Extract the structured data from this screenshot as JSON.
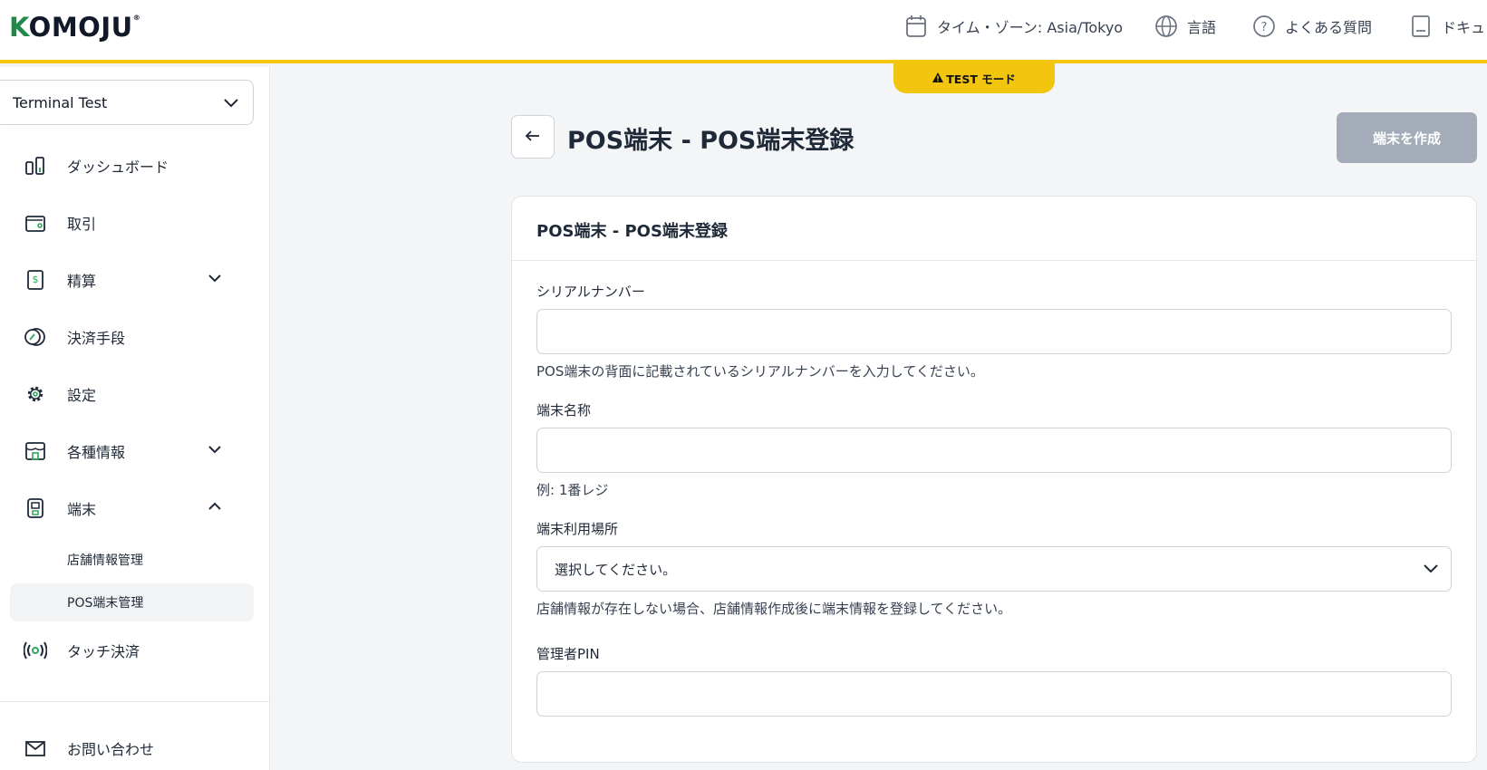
{
  "header": {
    "logo": "KOMOJU",
    "timezone_label": "タイム・ゾーン: Asia/Tokyo",
    "language_label": "言語",
    "faq_label": "よくある質問",
    "docs_label": "ドキュ"
  },
  "test_badge": "TEST モード",
  "sidebar": {
    "account": "Terminal Test",
    "items": [
      {
        "label": "ダッシュボード",
        "icon": "dashboard-icon"
      },
      {
        "label": "取引",
        "icon": "wallet-icon"
      },
      {
        "label": "精算",
        "icon": "settlement-icon",
        "expandable": true,
        "expanded": false
      },
      {
        "label": "決済手段",
        "icon": "payment-method-icon"
      },
      {
        "label": "設定",
        "icon": "gear-icon"
      },
      {
        "label": "各種情報",
        "icon": "store-icon",
        "expandable": true,
        "expanded": false
      },
      {
        "label": "端末",
        "icon": "terminal-icon",
        "expandable": true,
        "expanded": true
      }
    ],
    "subitems": [
      {
        "label": "店舗情報管理",
        "active": false
      },
      {
        "label": "POS端末管理",
        "active": true
      }
    ],
    "touch_payment": "タッチ決済",
    "contact": "お問い合わせ"
  },
  "page": {
    "title": "POS端末 - POS端末登録",
    "create_button": "端末を作成"
  },
  "card": {
    "title": "POS端末 - POS端末登録",
    "serial_label": "シリアルナンバー",
    "serial_value": "",
    "serial_help": "POS端末の背面に記載されているシリアルナンバーを入力してください。",
    "name_label": "端末名称",
    "name_value": "",
    "name_help": "例: 1番レジ",
    "location_label": "端末利用場所",
    "location_value": "選択してください。",
    "location_help": "店舗情報が存在しない場合、店舗情報作成後に端末情報を登録してください。",
    "pin_label": "管理者PIN",
    "pin_value": ""
  },
  "colors": {
    "accent_yellow": "#f2c50f",
    "brand_green": "#1f8a4c",
    "disabled_button": "#a3acb8"
  }
}
